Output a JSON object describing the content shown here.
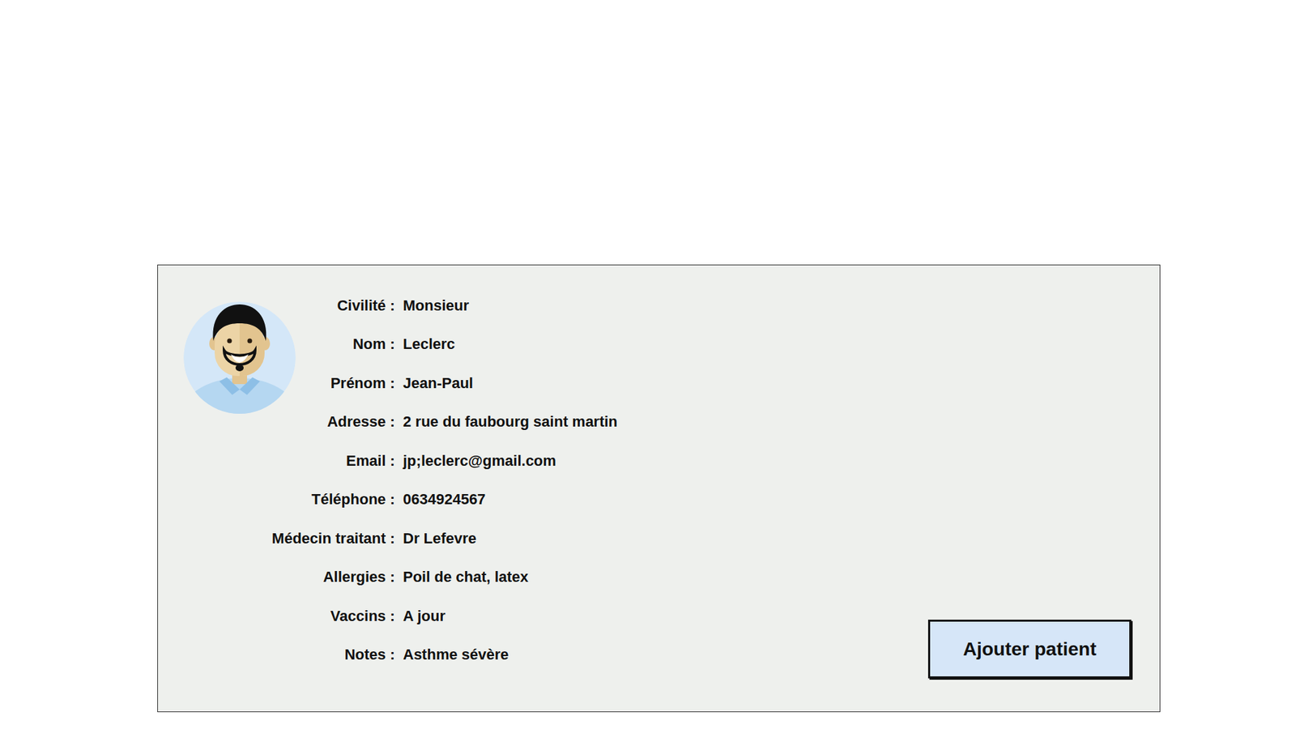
{
  "patient": {
    "fields": [
      {
        "label": "Civilité :",
        "value": "Monsieur"
      },
      {
        "label": "Nom :",
        "value": "Leclerc"
      },
      {
        "label": "Prénom :",
        "value": "Jean-Paul"
      },
      {
        "label": "Adresse :",
        "value": "2 rue du faubourg saint martin"
      },
      {
        "label": "Email :",
        "value": "jp;leclerc@gmail.com"
      },
      {
        "label": "Téléphone :",
        "value": "0634924567"
      },
      {
        "label": "Médecin traitant :",
        "value": "Dr Lefevre"
      },
      {
        "label": "Allergies :",
        "value": "Poil de chat, latex"
      },
      {
        "label": "Vaccins :",
        "value": "A jour"
      },
      {
        "label": "Notes :",
        "value": "Asthme sévère"
      }
    ]
  },
  "buttons": [
    "Ajouter patient"
  ]
}
